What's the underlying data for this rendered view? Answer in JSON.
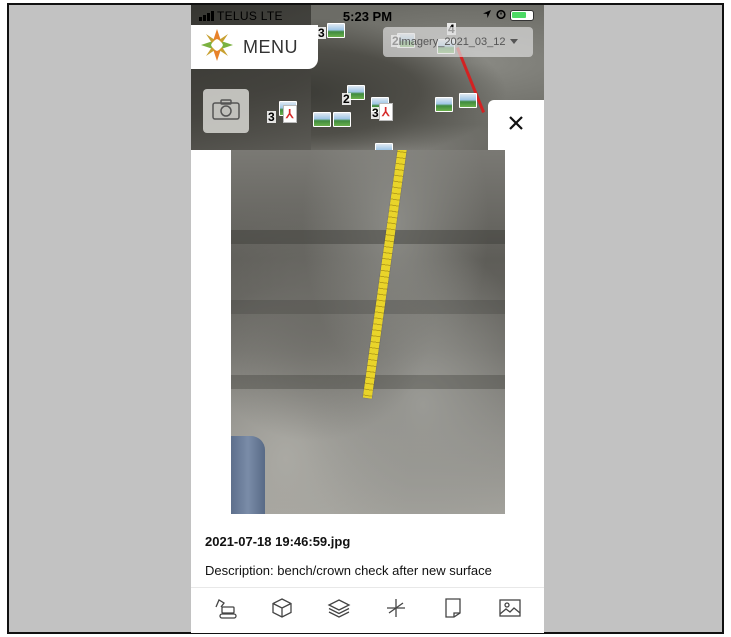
{
  "status_bar": {
    "carrier": "TELUS  LTE",
    "time": "5:23 PM"
  },
  "menu": {
    "label": "MENU"
  },
  "imagery_layer": {
    "selected": "Imagery_2021_03_12"
  },
  "map_markers": {
    "badge_a": "2",
    "badge_b": "3",
    "badge_c": "2",
    "badge_d": "3",
    "badge_e": "4"
  },
  "photo_detail": {
    "filename": "2021-07-18 19:46:59.jpg",
    "description": "Description: bench/crown check after new surface"
  },
  "colors": {
    "tape": "#e9d42a",
    "route_line": "#d32222",
    "logo_orange": "#e8822a",
    "logo_green": "#7bb241"
  },
  "toolbar": {
    "tools": [
      "excavator-icon",
      "box-3d-icon",
      "layers-icon",
      "measure-icon",
      "note-icon",
      "image-icon"
    ]
  }
}
